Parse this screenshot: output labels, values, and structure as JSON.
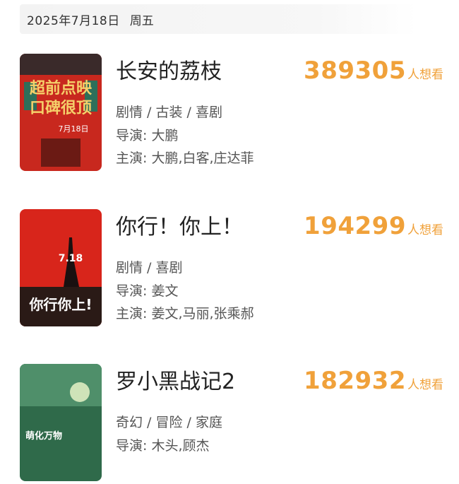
{
  "header": {
    "date": "2025年7月18日",
    "weekday": "周五"
  },
  "movies": [
    {
      "title": "长安的荔枝",
      "genre": "剧情 / 古装 / 喜剧",
      "director": "导演: 大鹏",
      "cast": "主演: 大鹏,白客,庄达菲",
      "want_count": "389305",
      "want_unit": "人想看",
      "poster_text": [
        "超前点映",
        "口碑很顶",
        "7月18日"
      ]
    },
    {
      "title": "你行！你上！",
      "genre": "剧情 / 喜剧",
      "director": "导演: 姜文",
      "cast": "主演: 姜文,马丽,张乘郝",
      "want_count": "194299",
      "want_unit": "人想看",
      "poster_text": [
        "你行你上!",
        "7.18"
      ]
    },
    {
      "title": "罗小黑战记2",
      "genre": "奇幻 / 冒险 / 家庭",
      "director": "导演: 木头,顾杰",
      "want_count": "182932",
      "want_unit": "人想看",
      "poster_text": [
        "萌化万物"
      ]
    }
  ],
  "colors": {
    "accent": "#f0a13a",
    "poster1": "#c8281e",
    "poster2": "#d8251b",
    "poster3": "#2f6a4a"
  }
}
